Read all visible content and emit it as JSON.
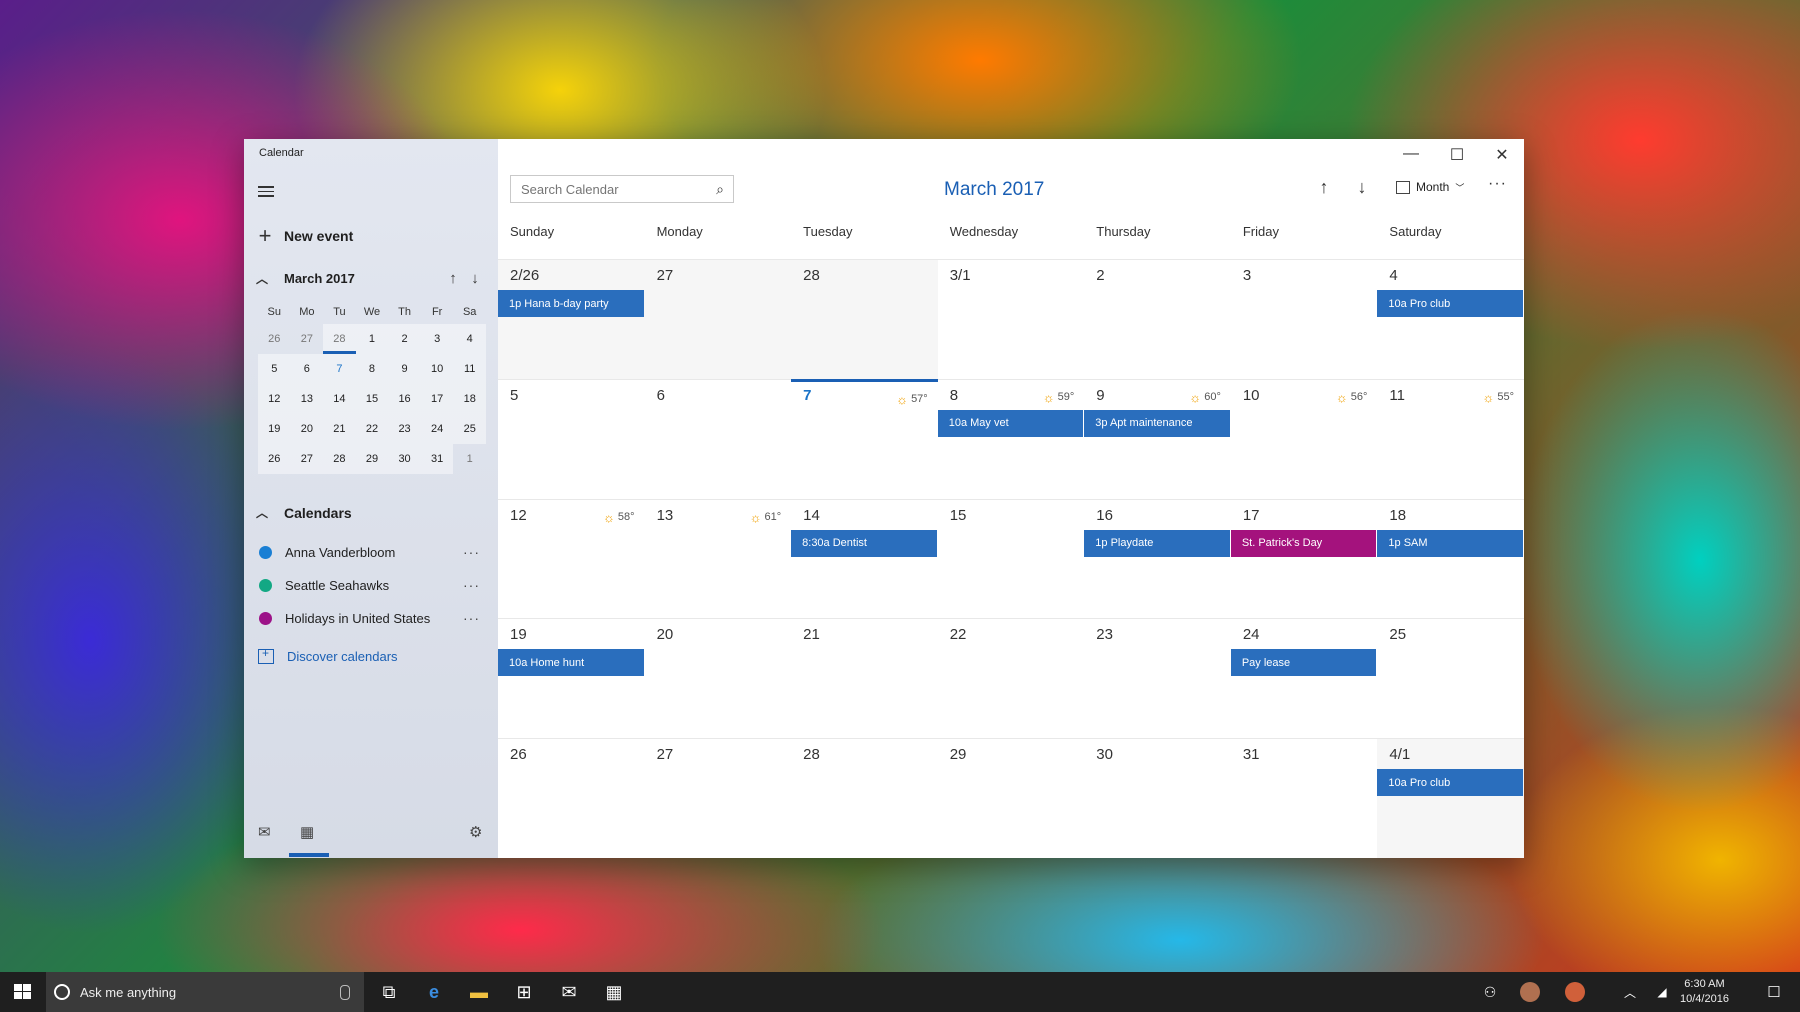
{
  "window": {
    "app_title": "Calendar",
    "minimize": "—",
    "maximize": "☐",
    "close": "✕"
  },
  "sidebar": {
    "new_event": "New event",
    "mini_calendar": {
      "title": "March 2017",
      "weekdays": [
        "Su",
        "Mo",
        "Tu",
        "We",
        "Th",
        "Fr",
        "Sa"
      ],
      "days": [
        {
          "label": "26",
          "state": "other"
        },
        {
          "label": "27",
          "state": "other"
        },
        {
          "label": "28",
          "state": "other-selected"
        },
        {
          "label": "1",
          "state": "current"
        },
        {
          "label": "2",
          "state": "current"
        },
        {
          "label": "3",
          "state": "current"
        },
        {
          "label": "4",
          "state": "current"
        },
        {
          "label": "5",
          "state": "current"
        },
        {
          "label": "6",
          "state": "current"
        },
        {
          "label": "7",
          "state": "today"
        },
        {
          "label": "8",
          "state": "current"
        },
        {
          "label": "9",
          "state": "current"
        },
        {
          "label": "10",
          "state": "current"
        },
        {
          "label": "11",
          "state": "current"
        },
        {
          "label": "12",
          "state": "current"
        },
        {
          "label": "13",
          "state": "current"
        },
        {
          "label": "14",
          "state": "current"
        },
        {
          "label": "15",
          "state": "current"
        },
        {
          "label": "16",
          "state": "current"
        },
        {
          "label": "17",
          "state": "current"
        },
        {
          "label": "18",
          "state": "current"
        },
        {
          "label": "19",
          "state": "current"
        },
        {
          "label": "20",
          "state": "current"
        },
        {
          "label": "21",
          "state": "current"
        },
        {
          "label": "22",
          "state": "current"
        },
        {
          "label": "23",
          "state": "current"
        },
        {
          "label": "24",
          "state": "current"
        },
        {
          "label": "25",
          "state": "current"
        },
        {
          "label": "26",
          "state": "current"
        },
        {
          "label": "27",
          "state": "current"
        },
        {
          "label": "28",
          "state": "current"
        },
        {
          "label": "29",
          "state": "current"
        },
        {
          "label": "30",
          "state": "current"
        },
        {
          "label": "31",
          "state": "current"
        },
        {
          "label": "1",
          "state": "other"
        }
      ]
    },
    "calendars_title": "Calendars",
    "calendars": [
      {
        "name": "Anna Vanderbloom",
        "color": "#1a7fd4"
      },
      {
        "name": "Seattle Seahawks",
        "color": "#13a884"
      },
      {
        "name": "Holidays in United States",
        "color": "#9c1288"
      }
    ],
    "more": "···",
    "discover": "Discover calendars"
  },
  "toolbar": {
    "search_placeholder": "Search Calendar",
    "month_title": "March 2017",
    "view": "Month",
    "more": "···"
  },
  "weekdays": [
    "Sunday",
    "Monday",
    "Tuesday",
    "Wednesday",
    "Thursday",
    "Friday",
    "Saturday"
  ],
  "cells": [
    {
      "num": "2/26",
      "state": "out",
      "events": [
        {
          "title": "1p Hana b-day party",
          "color": "blue"
        }
      ]
    },
    {
      "num": "27",
      "state": "out",
      "events": []
    },
    {
      "num": "28",
      "state": "out",
      "events": []
    },
    {
      "num": "3/1",
      "state": "in",
      "events": []
    },
    {
      "num": "2",
      "state": "in",
      "events": []
    },
    {
      "num": "3",
      "state": "in",
      "events": []
    },
    {
      "num": "4",
      "state": "in",
      "events": [
        {
          "title": "10a Pro club",
          "color": "blue"
        }
      ]
    },
    {
      "num": "5",
      "state": "in",
      "events": []
    },
    {
      "num": "6",
      "state": "in",
      "events": []
    },
    {
      "num": "7",
      "state": "today",
      "weather": "57°",
      "events": []
    },
    {
      "num": "8",
      "state": "in",
      "weather": "59°",
      "events": [
        {
          "title": "10a May vet",
          "color": "blue"
        }
      ]
    },
    {
      "num": "9",
      "state": "in",
      "weather": "60°",
      "events": [
        {
          "title": "3p Apt maintenance",
          "color": "blue"
        }
      ]
    },
    {
      "num": "10",
      "state": "in",
      "weather": "56°",
      "events": []
    },
    {
      "num": "11",
      "state": "in",
      "weather": "55°",
      "events": []
    },
    {
      "num": "12",
      "state": "in",
      "weather": "58°",
      "events": []
    },
    {
      "num": "13",
      "state": "in",
      "weather": "61°",
      "events": []
    },
    {
      "num": "14",
      "state": "in",
      "events": [
        {
          "title": "8:30a Dentist",
          "color": "blue"
        }
      ]
    },
    {
      "num": "15",
      "state": "in",
      "events": []
    },
    {
      "num": "16",
      "state": "in",
      "events": [
        {
          "title": "1p Playdate",
          "color": "blue"
        }
      ]
    },
    {
      "num": "17",
      "state": "in",
      "events": [
        {
          "title": "St. Patrick's Day",
          "color": "purple"
        }
      ]
    },
    {
      "num": "18",
      "state": "in",
      "events": [
        {
          "title": "1p SAM",
          "color": "blue"
        }
      ]
    },
    {
      "num": "19",
      "state": "in",
      "events": [
        {
          "title": "10a Home hunt",
          "color": "blue"
        }
      ]
    },
    {
      "num": "20",
      "state": "in",
      "events": []
    },
    {
      "num": "21",
      "state": "in",
      "events": []
    },
    {
      "num": "22",
      "state": "in",
      "events": []
    },
    {
      "num": "23",
      "state": "in",
      "events": []
    },
    {
      "num": "24",
      "state": "in",
      "events": [
        {
          "title": "Pay lease",
          "color": "blue"
        }
      ]
    },
    {
      "num": "25",
      "state": "in",
      "events": []
    },
    {
      "num": "26",
      "state": "in",
      "events": []
    },
    {
      "num": "27",
      "state": "in",
      "events": []
    },
    {
      "num": "28",
      "state": "in",
      "events": []
    },
    {
      "num": "29",
      "state": "in",
      "events": []
    },
    {
      "num": "30",
      "state": "in",
      "events": []
    },
    {
      "num": "31",
      "state": "in",
      "events": []
    },
    {
      "num": "4/1",
      "state": "out",
      "events": [
        {
          "title": "10a Pro club",
          "color": "blue"
        }
      ]
    }
  ],
  "taskbar": {
    "search_text": "Ask me anything",
    "time": "6:30 AM",
    "date": "10/4/2016"
  }
}
